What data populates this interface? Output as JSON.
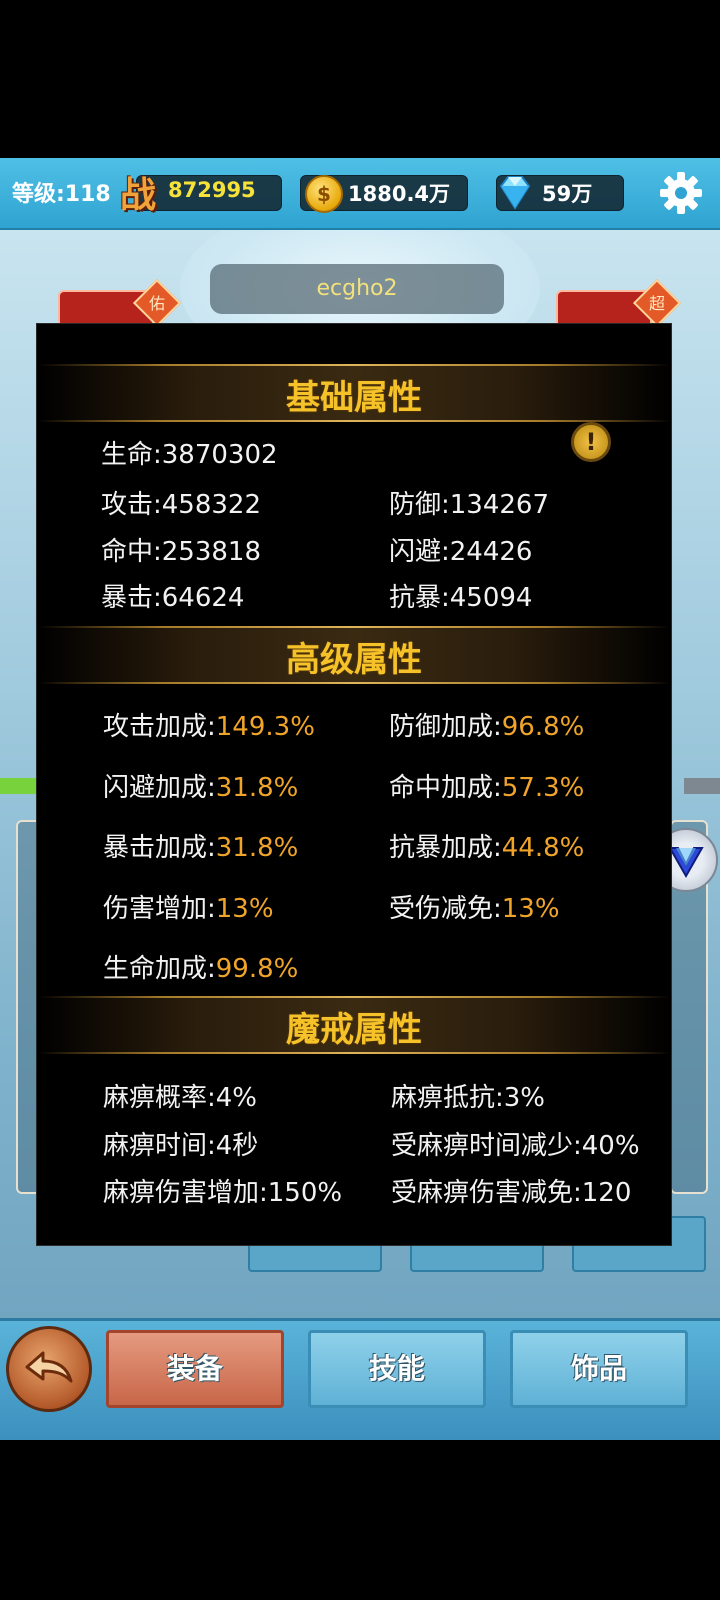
{
  "topbar": {
    "level": "等级:118",
    "power_icon_char": "战",
    "power": "872995",
    "gold": "1880.4万",
    "coin_char": "$",
    "diamonds": "59万"
  },
  "player_name": "ecgho2",
  "side_tags": {
    "left": "佑",
    "right": "超"
  },
  "stats_popup": {
    "basic": {
      "title": "基础属性",
      "hp": "生命:3870302",
      "attack": "攻击:458322",
      "defense": "防御:134267",
      "hit": "命中:253818",
      "dodge": "闪避:24426",
      "crit": "暴击:64624",
      "anticrit": "抗暴:45094",
      "info_char": "!"
    },
    "advanced": {
      "title": "高级属性",
      "rows": [
        {
          "label": "攻击加成:",
          "value": "149.3%"
        },
        {
          "label": "防御加成:",
          "value": "96.8%"
        },
        {
          "label": "闪避加成:",
          "value": "31.8%"
        },
        {
          "label": "命中加成:",
          "value": "57.3%"
        },
        {
          "label": "暴击加成:",
          "value": "31.8%"
        },
        {
          "label": "抗暴加成:",
          "value": "44.8%"
        },
        {
          "label": "伤害增加:",
          "value": "13%"
        },
        {
          "label": "受伤减免:",
          "value": "13%"
        },
        {
          "label": "生命加成:",
          "value": "99.8%"
        }
      ]
    },
    "ring": {
      "title": "魔戒属性",
      "rows": [
        "麻痹概率:4%",
        "麻痹抵抗:3%",
        "麻痹时间:4秒",
        "受麻痹时间减少:40%",
        "麻痹伤害增加:150%",
        "受麻痹伤害减免:120"
      ]
    }
  },
  "bottom_tabs": {
    "equip": "装备",
    "skills": "技能",
    "accessories": "饰品"
  },
  "colors": {
    "accent_gold": "#f6c22a",
    "value_orange": "#f0a52a",
    "topbar_blue": "#2fa3d1",
    "power_yellow": "#f7e23a"
  },
  "icons": [
    "power-icon",
    "gold-coin-icon",
    "diamond-icon",
    "gear-icon",
    "info-icon",
    "back-arrow-icon",
    "vip-icon"
  ]
}
